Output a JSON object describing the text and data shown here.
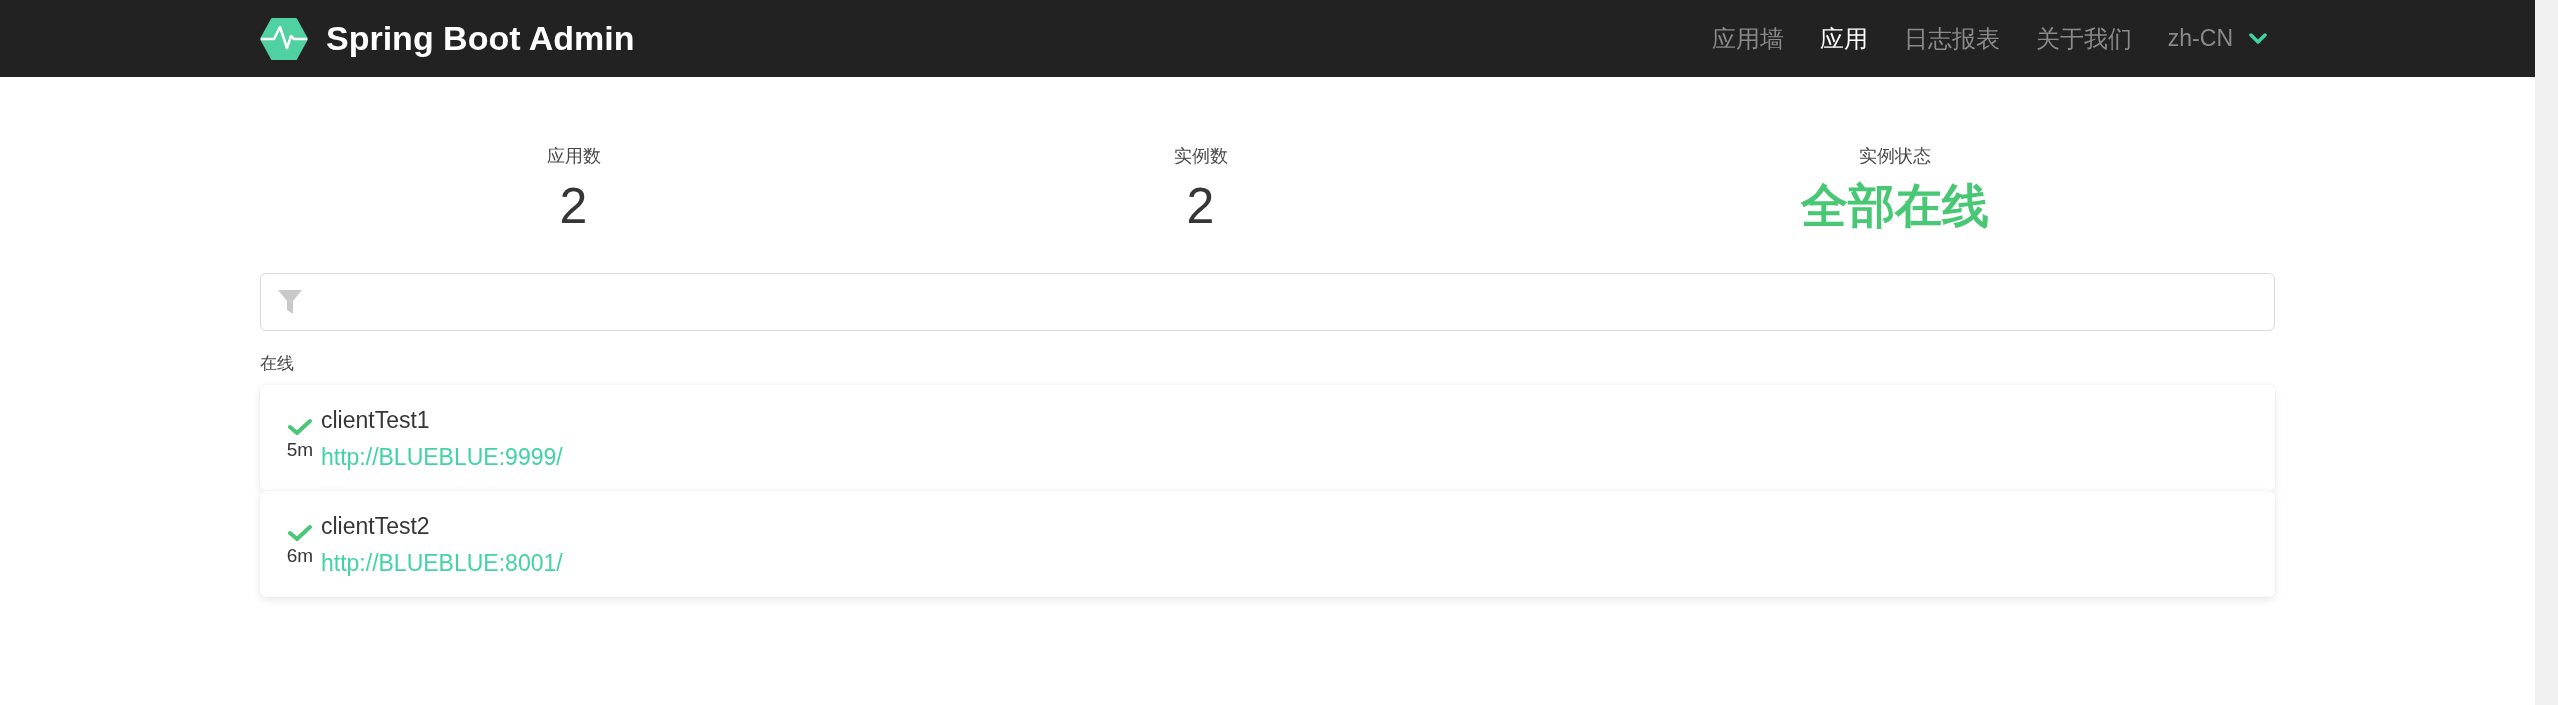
{
  "navbar": {
    "brand": "Spring Boot Admin",
    "items": [
      {
        "label": "应用墙",
        "selected": false
      },
      {
        "label": "应用",
        "selected": true
      },
      {
        "label": "日志报表",
        "selected": false
      },
      {
        "label": "关于我们",
        "selected": false
      }
    ],
    "language": "zh-CN"
  },
  "stats": [
    {
      "kind": "count",
      "label": "应用数",
      "value": "2"
    },
    {
      "kind": "count",
      "label": "实例数",
      "value": "2"
    },
    {
      "kind": "status",
      "label": "实例状态",
      "value": "全部在线"
    }
  ],
  "groups": [
    {
      "title": "在线",
      "applications": [
        {
          "name": "clientTest1",
          "uptime": "5m",
          "url": "http://BLUEBLUE:9999/",
          "up": true
        },
        {
          "name": "clientTest2",
          "uptime": "6m",
          "url": "http://BLUEBLUE:8001/",
          "up": true
        }
      ]
    }
  ]
}
